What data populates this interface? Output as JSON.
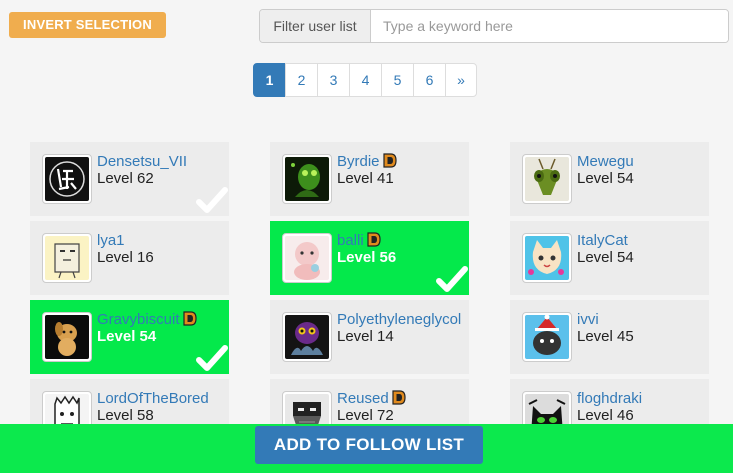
{
  "toolbar": {
    "invert_label": "INVERT SELECTION",
    "filter_label": "Filter user list",
    "filter_placeholder": "Type a keyword here",
    "filter_value": ""
  },
  "pagination": {
    "pages": [
      "1",
      "2",
      "3",
      "4",
      "5",
      "6"
    ],
    "next": "»",
    "active": "1"
  },
  "users": [
    {
      "name": "Densetsu_VII",
      "level": "Level 62",
      "selected": true,
      "badge": false,
      "avatar_icon": "calligraphy-avatar-icon"
    },
    {
      "name": "Byrdie",
      "level": "Level 41",
      "selected": false,
      "badge": true,
      "avatar_icon": "green-creature-avatar-icon"
    },
    {
      "name": "Mewegu",
      "level": "Level 54",
      "selected": false,
      "badge": false,
      "avatar_icon": "mantis-avatar-icon"
    },
    {
      "name": "lya1",
      "level": "Level 16",
      "selected": false,
      "badge": false,
      "avatar_icon": "paper-bag-avatar-icon"
    },
    {
      "name": "balli",
      "level": "Level 56",
      "selected": true,
      "badge": true,
      "avatar_icon": "pink-baby-avatar-icon"
    },
    {
      "name": "ItalyCat",
      "level": "Level 54",
      "selected": false,
      "badge": false,
      "avatar_icon": "anime-cat-avatar-icon"
    },
    {
      "name": "Gravybiscuit",
      "level": "Level 54",
      "selected": true,
      "badge": true,
      "avatar_icon": "dog-avatar-icon"
    },
    {
      "name": "Polyethyleneglycol",
      "level": "Level 14",
      "selected": false,
      "badge": false,
      "avatar_icon": "dark-creature-avatar-icon"
    },
    {
      "name": "ivvi",
      "level": "Level 45",
      "selected": false,
      "badge": false,
      "avatar_icon": "santa-cat-avatar-icon"
    },
    {
      "name": "LordOfTheBored",
      "level": "Level 58",
      "selected": false,
      "badge": false,
      "avatar_icon": "sketch-face-avatar-icon"
    },
    {
      "name": "Reused",
      "level": "Level 72",
      "selected": false,
      "badge": true,
      "avatar_icon": "masked-face-avatar-icon"
    },
    {
      "name": "floghdraki",
      "level": "Level 46",
      "selected": false,
      "badge": false,
      "avatar_icon": "black-cat-avatar-icon"
    }
  ],
  "footer": {
    "add_label": "ADD TO FOLLOW LIST"
  },
  "colors": {
    "selected_card": "#04e94b",
    "unselected_card": "#ececec",
    "primary": "#337ab7",
    "warning": "#f0ad4e",
    "footer_bar": "#0ce94d",
    "badge": "#e08a1e"
  }
}
